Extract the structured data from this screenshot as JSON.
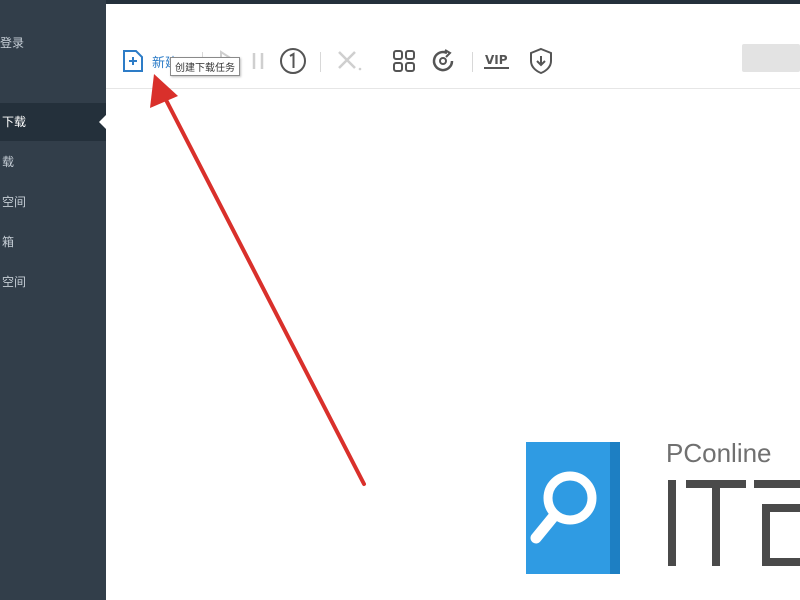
{
  "sidebar": {
    "login": "登录",
    "items": [
      {
        "label": "下载",
        "active": true
      },
      {
        "label": "载"
      },
      {
        "label": "空间"
      },
      {
        "label": "箱"
      },
      {
        "label": "空间"
      }
    ]
  },
  "toolbar": {
    "new_label": "新建",
    "vip_label": "VIP",
    "tooltip": "创建下载任务",
    "buttons": [
      "new-task-icon",
      "play-icon",
      "pause-icon",
      "speed-limit-icon",
      "delete-icon",
      "grid-view-icon",
      "refresh-icon",
      "vip-icon",
      "shield-icon"
    ]
  },
  "watermark": {
    "brand": "PConline",
    "it_text": "IT百"
  },
  "colors": {
    "sidebar_bg": "#323e4a",
    "sidebar_active": "#24303b",
    "accent_blue": "#2d7cc7",
    "arrow_red": "#d9302b",
    "logo_blue": "#2f9be3"
  }
}
